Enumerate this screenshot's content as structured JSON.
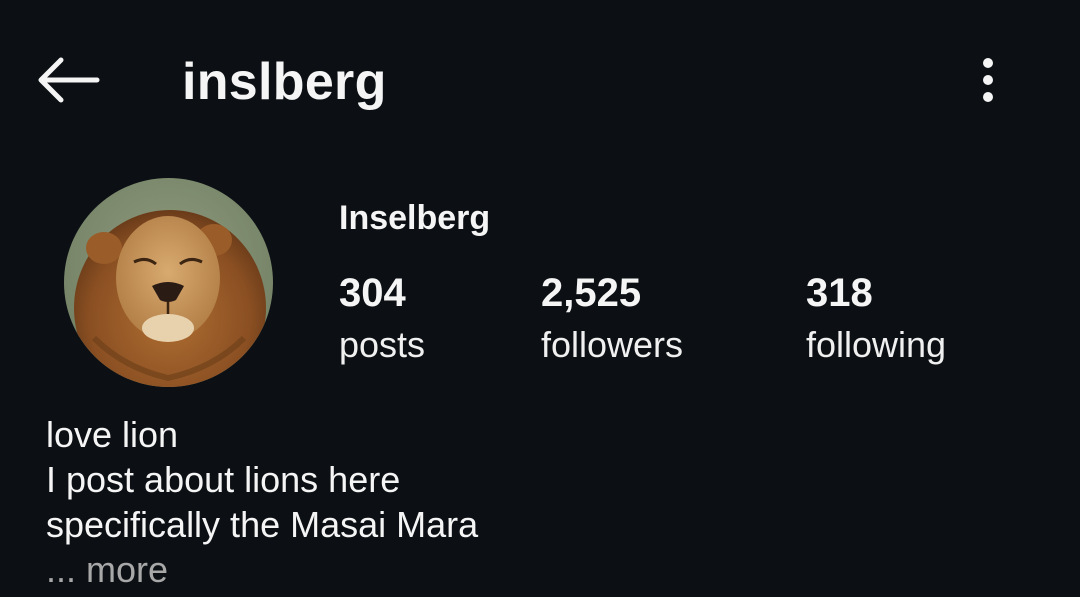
{
  "header": {
    "username": "inslberg",
    "back_icon": "back-arrow-icon",
    "more_icon": "more-vertical-icon"
  },
  "profile": {
    "display_name": "Inselberg",
    "avatar": "lion-profile-photo",
    "stats": {
      "posts": {
        "value": "304",
        "label": "posts"
      },
      "followers": {
        "value": "2,525",
        "label": "followers"
      },
      "following": {
        "value": "318",
        "label": "following"
      }
    },
    "bio": {
      "line1": "love lion",
      "line2": "I post about lions here",
      "line3": "specifically the Masai Mara",
      "more": "... more"
    }
  },
  "colors": {
    "background": "#0c1014",
    "text": "#f5f5f5",
    "muted": "#a8a8a8"
  }
}
